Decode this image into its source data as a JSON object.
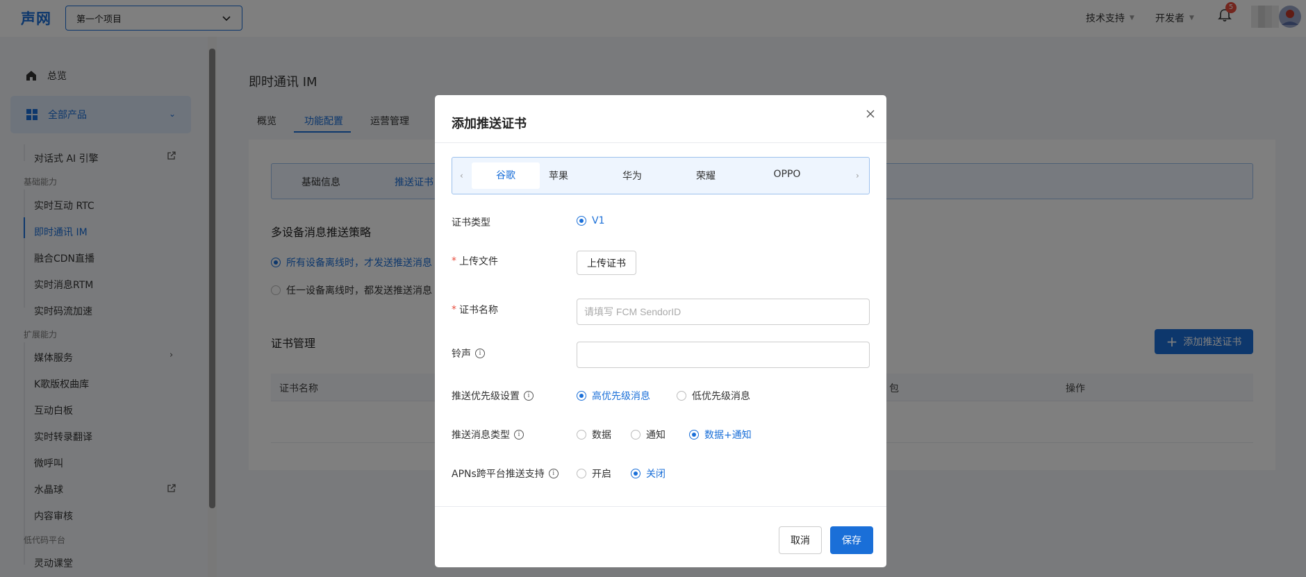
{
  "header": {
    "logo": "声网",
    "project": "第一个项目",
    "nav": [
      "技术支持",
      "开发者"
    ],
    "notification_count": "5"
  },
  "sidebar": {
    "overview": "总览",
    "all_products": "全部产品",
    "ai_engine": "对话式 AI 引擎",
    "group_basic": "基础能力",
    "rtc": "实时互动 RTC",
    "im": "即时通讯 IM",
    "cdn": "融合CDN直播",
    "rtm": "实时消息RTM",
    "stream": "实时码流加速",
    "group_ext": "扩展能力",
    "media": "媒体服务",
    "ktv": "K歌版权曲库",
    "whiteboard": "互动白板",
    "transcribe": "实时转录翻译",
    "call": "微呼叫",
    "crystal": "水晶球",
    "moderation": "内容审核",
    "group_lowcode": "低代码平台",
    "classroom": "灵动课堂"
  },
  "main": {
    "title": "即时通讯 IM",
    "tabs": [
      "概览",
      "功能配置",
      "运营管理"
    ],
    "subtabs": [
      "基础信息",
      "推送证书"
    ],
    "strategy_title": "多设备消息推送策略",
    "strategy_options": [
      "所有设备离线时，才发送推送消息",
      "任一设备离线时，都发送推送消息"
    ],
    "cert_title": "证书管理",
    "add_cert_label": "添加推送证书",
    "columns": [
      "证书名称",
      "包",
      "操作"
    ]
  },
  "modal": {
    "title": "添加推送证书",
    "platforms": [
      "谷歌",
      "苹果",
      "华为",
      "荣耀",
      "OPPO"
    ],
    "active_platform": "谷歌",
    "cert_type_label": "证书类型",
    "cert_type_value": "V1",
    "upload_label": "上传文件",
    "upload_button": "上传证书",
    "cert_name_label": "证书名称",
    "cert_name_placeholder": "请填写 FCM SendorID",
    "ringtone_label": "铃声",
    "priority_label": "推送优先级设置",
    "priority_options": [
      "高优先级消息",
      "低优先级消息"
    ],
    "msgtype_label": "推送消息类型",
    "msgtype_options": [
      "数据",
      "通知",
      "数据+通知"
    ],
    "apns_label": "APNs跨平台推送支持",
    "apns_options": [
      "开启",
      "关闭"
    ],
    "cancel": "取消",
    "save": "保存"
  },
  "colors": {
    "accent": "#1a6fd8",
    "badge": "#e74c3c"
  }
}
